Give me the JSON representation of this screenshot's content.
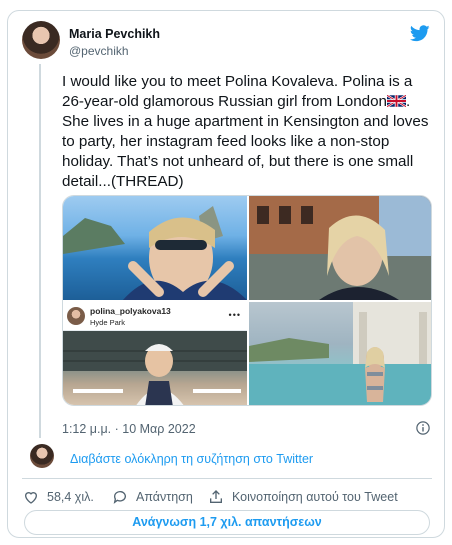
{
  "tweet": {
    "author_name": "Maria Pevchikh",
    "author_handle": "@pevchikh",
    "text_before_flag": "I would like you to meet Polina Kovaleva. Polina is a 26-year-old glamorous Russian girl from London",
    "text_after_flag": ". She lives in a huge apartment in Kensington and loves to party, her instagram feed looks like a non-stop holiday. That’s not unheard of, but there is one small detail...(THREAD)",
    "timestamp": "1:12 μ.μ. · 10 Μαρ 2022"
  },
  "instagram": {
    "username": "polina_polyakova13",
    "location": "Hyde Park",
    "dots": "•••"
  },
  "thread_link": "Διαβάστε ολόκληρη τη συζήτηση στο Twitter",
  "actions": {
    "likes": "58,4 χιλ.",
    "reply": "Απάντηση",
    "share": "Κοινοποίηση αυτού του Tweet"
  },
  "read_replies": "Ανάγνωση 1,7 χιλ. απαντήσεων",
  "colors": {
    "accent": "#1d9bf0",
    "text": "#0f1419",
    "secondary": "#536471",
    "border": "#cfd9de"
  },
  "icons": [
    "twitter-bird-icon",
    "uk-flag-icon",
    "info-icon",
    "heart-icon",
    "reply-icon",
    "share-icon"
  ]
}
